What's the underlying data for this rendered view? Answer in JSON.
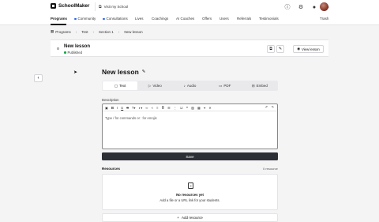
{
  "brand": {
    "name": "SchoolMaker"
  },
  "topbar": {
    "visit_label": "Visit my School",
    "icons": [
      "help-icon",
      "settings-icon",
      "chat-icon",
      "bell-icon"
    ]
  },
  "nav": {
    "items": [
      {
        "label": "Programs",
        "active": true,
        "dot": false
      },
      {
        "label": "Community",
        "active": false,
        "dot": true
      },
      {
        "label": "Consultations",
        "active": false,
        "dot": true
      },
      {
        "label": "Lives",
        "active": false,
        "dot": false
      },
      {
        "label": "Coachings",
        "active": false,
        "dot": false
      },
      {
        "label": "AI Coaches",
        "active": false,
        "dot": false
      },
      {
        "label": "Offers",
        "active": false,
        "dot": false
      },
      {
        "label": "Users",
        "active": false,
        "dot": false
      },
      {
        "label": "Referrals",
        "active": false,
        "dot": false
      },
      {
        "label": "Testimonials",
        "active": false,
        "dot": false
      }
    ],
    "trash": "Trash"
  },
  "breadcrumb": {
    "items": [
      "Programs",
      "Test",
      "Section 1",
      "New lesson"
    ]
  },
  "lesson_header": {
    "title": "New lesson",
    "status": "Published",
    "view_label": "View lesson"
  },
  "main": {
    "title": "New lesson",
    "tabs": [
      {
        "label": "Text",
        "icon": "text-icon",
        "active": true
      },
      {
        "label": "Video",
        "icon": "video-icon",
        "active": false
      },
      {
        "label": "Audio",
        "icon": "audio-icon",
        "active": false
      },
      {
        "label": "PDF",
        "icon": "pdf-icon",
        "active": false
      },
      {
        "label": "Embed",
        "icon": "embed-icon",
        "active": false
      }
    ],
    "description_label": "Description",
    "editor_placeholder": "Type  /  for commands or  :  for emojis",
    "save_label": "Save"
  },
  "resources": {
    "label": "Resources",
    "count": "0 resource",
    "empty_title": "No resources yet",
    "empty_sub": "Add a file or a URL link for your students.",
    "add_label": "Add resource"
  }
}
